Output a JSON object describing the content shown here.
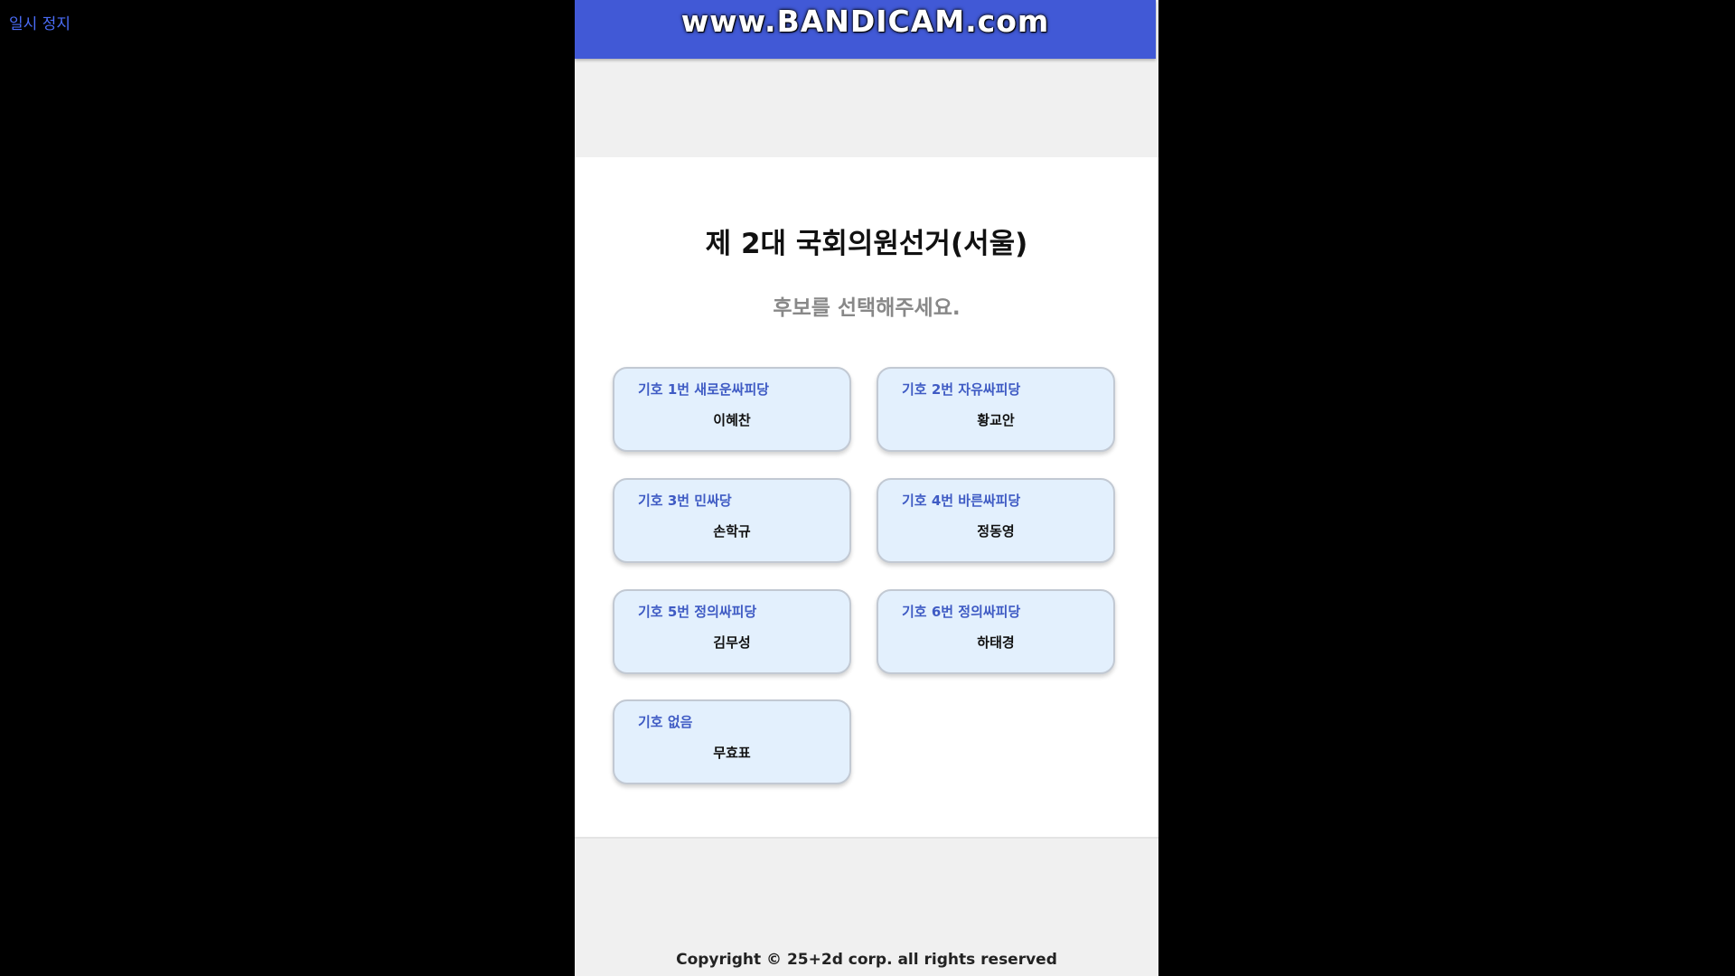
{
  "overlay": {
    "pause_label": "일시 정지"
  },
  "watermark": {
    "text": "www.BANDICAM.com"
  },
  "ballot": {
    "title": "제 2대 국회의원선거(서울)",
    "subtitle": "후보를 선택해주세요.",
    "candidates": [
      {
        "party": "기호 1번 새로운싸피당",
        "name": "이혜찬"
      },
      {
        "party": "기호 2번 자유싸피당",
        "name": "황교안"
      },
      {
        "party": "기호 3번 민싸당",
        "name": "손학규"
      },
      {
        "party": "기호 4번 바른싸피당",
        "name": "정동영"
      },
      {
        "party": "기호 5번 정의싸피당",
        "name": "김무성"
      },
      {
        "party": "기호 6번 정의싸피당",
        "name": "하태경"
      },
      {
        "party": "기호 없음",
        "name": "무효표"
      }
    ]
  },
  "footer": {
    "copyright": "Copyright © 25+2d corp. all rights reserved"
  },
  "colors": {
    "header_bar": "#4159d6",
    "card_background": "#e3f0fd",
    "party_text": "#3f5bc4"
  }
}
